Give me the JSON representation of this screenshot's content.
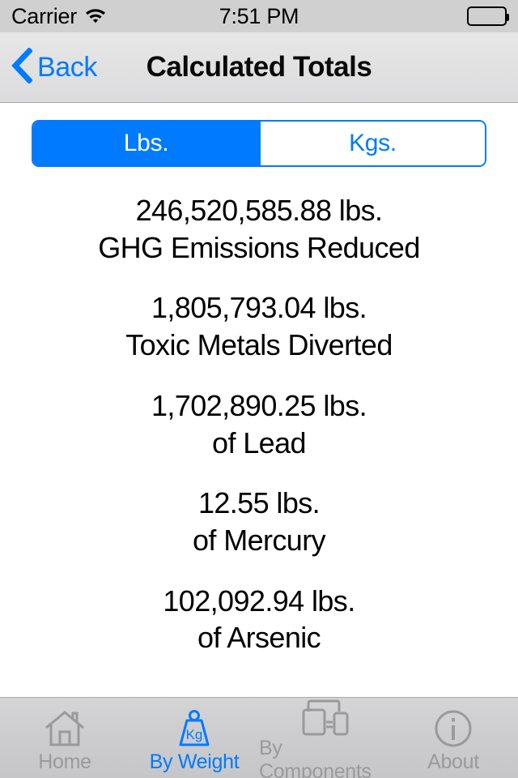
{
  "status_bar": {
    "carrier": "Carrier",
    "wifi_icon": "wifi-icon",
    "time": "7:51 PM",
    "battery_icon": "battery-full-icon"
  },
  "nav_bar": {
    "back_icon": "chevron-left-icon",
    "back_label": "Back",
    "title": "Calculated Totals"
  },
  "segmented_control": {
    "options": [
      {
        "label": "Lbs.",
        "selected": true
      },
      {
        "label": "Kgs.",
        "selected": false
      }
    ],
    "selected_value": "Lbs.",
    "accent_color": "#007aff"
  },
  "stats": [
    {
      "value": "246,520,585.88 lbs.",
      "label": "GHG Emissions Reduced"
    },
    {
      "value": "1,805,793.04 lbs.",
      "label": "Toxic Metals Diverted"
    },
    {
      "value": "1,702,890.25 lbs.",
      "label": "of Lead"
    },
    {
      "value": "12.55 lbs.",
      "label": "of Mercury"
    },
    {
      "value": "102,092.94 lbs.",
      "label": "of Arsenic"
    }
  ],
  "tab_bar": {
    "items": [
      {
        "label": "Home",
        "icon": "house-icon",
        "active": false
      },
      {
        "label": "By Weight",
        "icon": "weight-kg-icon",
        "active": true
      },
      {
        "label": "By Components",
        "icon": "devices-icon",
        "active": false
      },
      {
        "label": "About",
        "icon": "info-circle-icon",
        "active": false
      }
    ],
    "active_color": "#007aff",
    "inactive_color": "#9a9a9d"
  }
}
